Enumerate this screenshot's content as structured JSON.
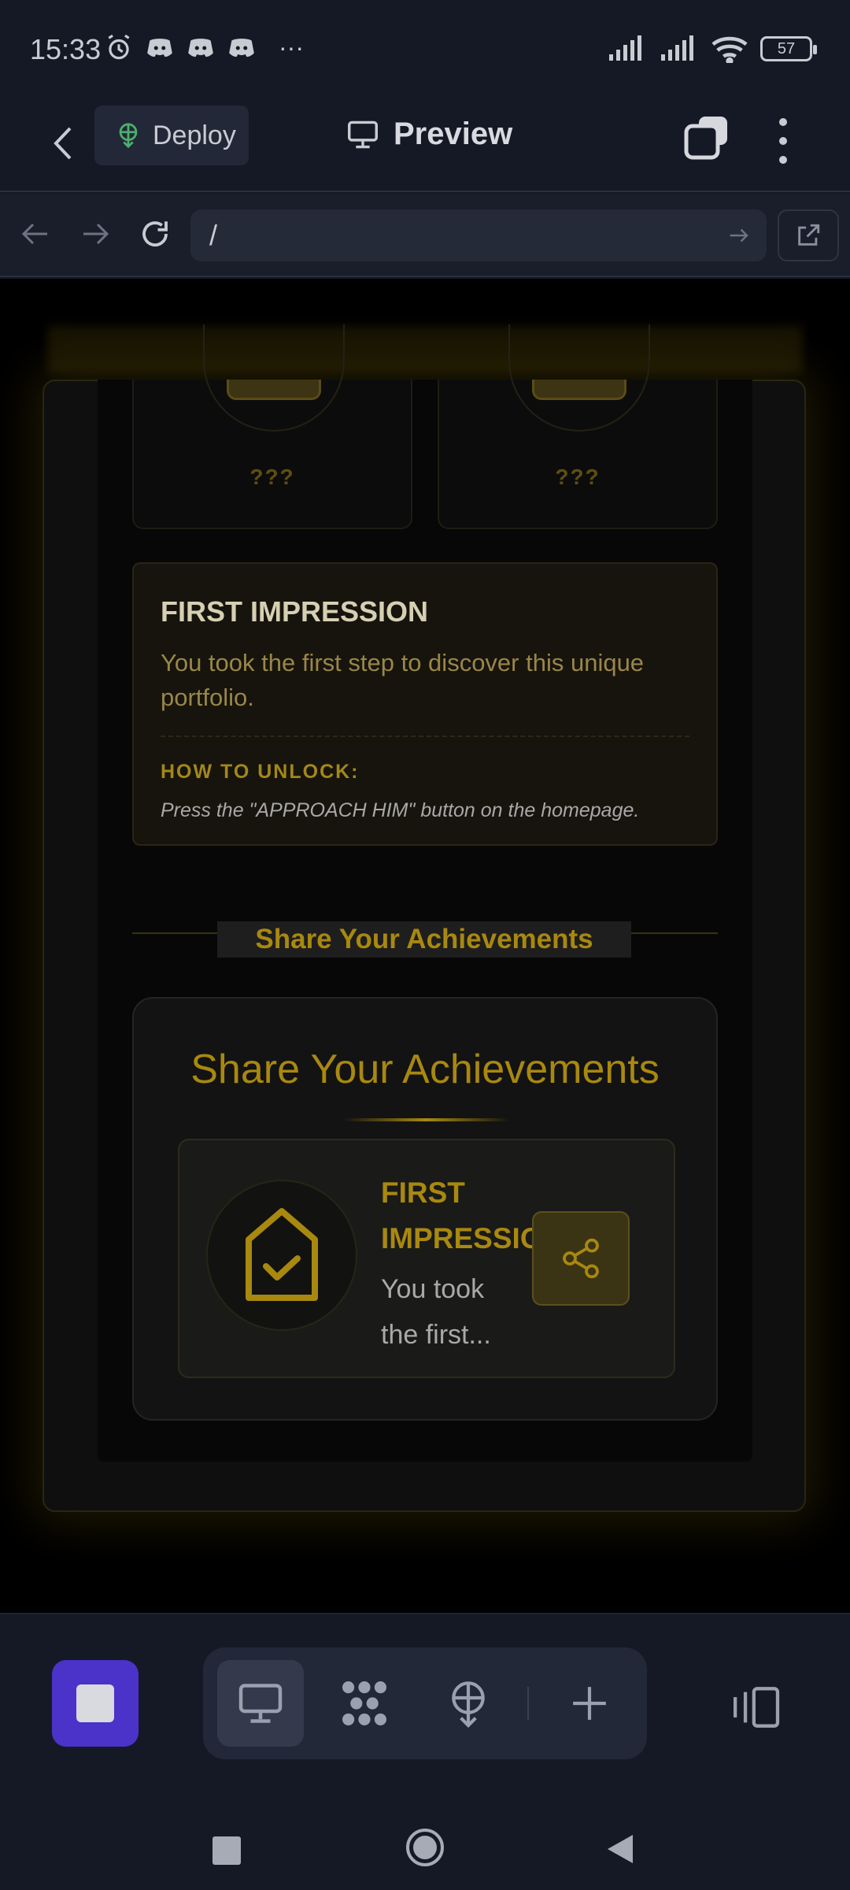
{
  "status_bar": {
    "time": "15:33",
    "more": "···",
    "battery": "57"
  },
  "header": {
    "deploy_label": "Deploy",
    "title": "Preview"
  },
  "url_bar": {
    "url": "/"
  },
  "page": {
    "locked_cards": [
      {
        "label": "???"
      },
      {
        "label": "???"
      }
    ],
    "detail": {
      "title": "FIRST IMPRESSION",
      "description": "You took the first step to discover this unique portfolio.",
      "unlock_heading": "HOW TO UNLOCK:",
      "unlock_text": "Press the \"APPROACH HIM\" button on the homepage."
    },
    "share_section_heading": "Share Your Achievements",
    "share_panel": {
      "title": "Share Your Achievements",
      "card_title": "FIRST IMPRESSION",
      "card_desc": "You took the first..."
    }
  },
  "colors": {
    "accent_gold": "#a8880f",
    "stop_button": "#4b32c8",
    "deploy_icon": "#4caf6a"
  }
}
